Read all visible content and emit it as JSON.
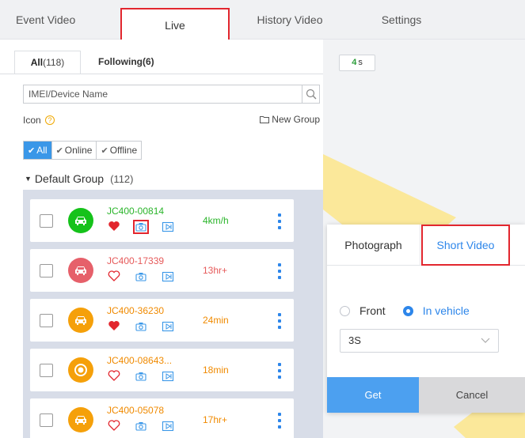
{
  "nav": {
    "tabs": [
      "Event Video",
      "Live",
      "History Video",
      "Settings"
    ],
    "active": "Live"
  },
  "list": {
    "subtabs": {
      "all_label": "All",
      "all_count": "(118)",
      "following": "Following(6)"
    },
    "search_placeholder": "IMEI/Device Name",
    "icon_label": "Icon",
    "help_glyph": "?",
    "new_group": "New Group",
    "filters": {
      "all": "All",
      "online": "Online",
      "offline": "Offline",
      "check": "✔"
    },
    "group": {
      "name": "Default Group",
      "count": "(112)",
      "caret": "▼"
    },
    "devices": [
      {
        "name": "JC400-00814",
        "status": "4km/h",
        "name_color": "#2bb52b",
        "status_color": "#2bb52b",
        "avatar_color": "#15c21a",
        "avatar_icon": "car-icon",
        "favorite": true,
        "highlighted_camera": true
      },
      {
        "name": "JC400-17339",
        "status": "13hr+",
        "name_color": "#e65a5a",
        "status_color": "#e65a5a",
        "avatar_color": "#e6606a",
        "avatar_icon": "car-icon",
        "favorite": false,
        "highlighted_camera": false
      },
      {
        "name": "JC400-36230",
        "status": "24min",
        "name_color": "#f08a00",
        "status_color": "#f08a00",
        "avatar_color": "#f5a00a",
        "avatar_icon": "car-icon",
        "favorite": true,
        "highlighted_camera": false
      },
      {
        "name": "JC400-08643...",
        "status": "18min",
        "name_color": "#f08a00",
        "status_color": "#f08a00",
        "avatar_color": "#f5a00a",
        "avatar_icon": "target-icon",
        "favorite": false,
        "highlighted_camera": false
      },
      {
        "name": "JC400-05078",
        "status": "17hr+",
        "name_color": "#f08a00",
        "status_color": "#f08a00",
        "avatar_color": "#f5a00a",
        "avatar_icon": "car-icon",
        "favorite": false,
        "highlighted_camera": false
      }
    ]
  },
  "map": {
    "timer_value": "4",
    "timer_unit": "s"
  },
  "popup": {
    "tabs": {
      "photograph": "Photograph",
      "short_video": "Short Video"
    },
    "active_tab": "Short Video",
    "radio_front": "Front",
    "radio_invehicle": "In vehicle",
    "selected_radio": "In vehicle",
    "duration_value": "3S",
    "get_label": "Get",
    "cancel_label": "Cancel"
  },
  "colors": {
    "accent_blue": "#2d86ea",
    "highlight_red": "#e2262e",
    "map_yellow": "#fbe89a"
  }
}
